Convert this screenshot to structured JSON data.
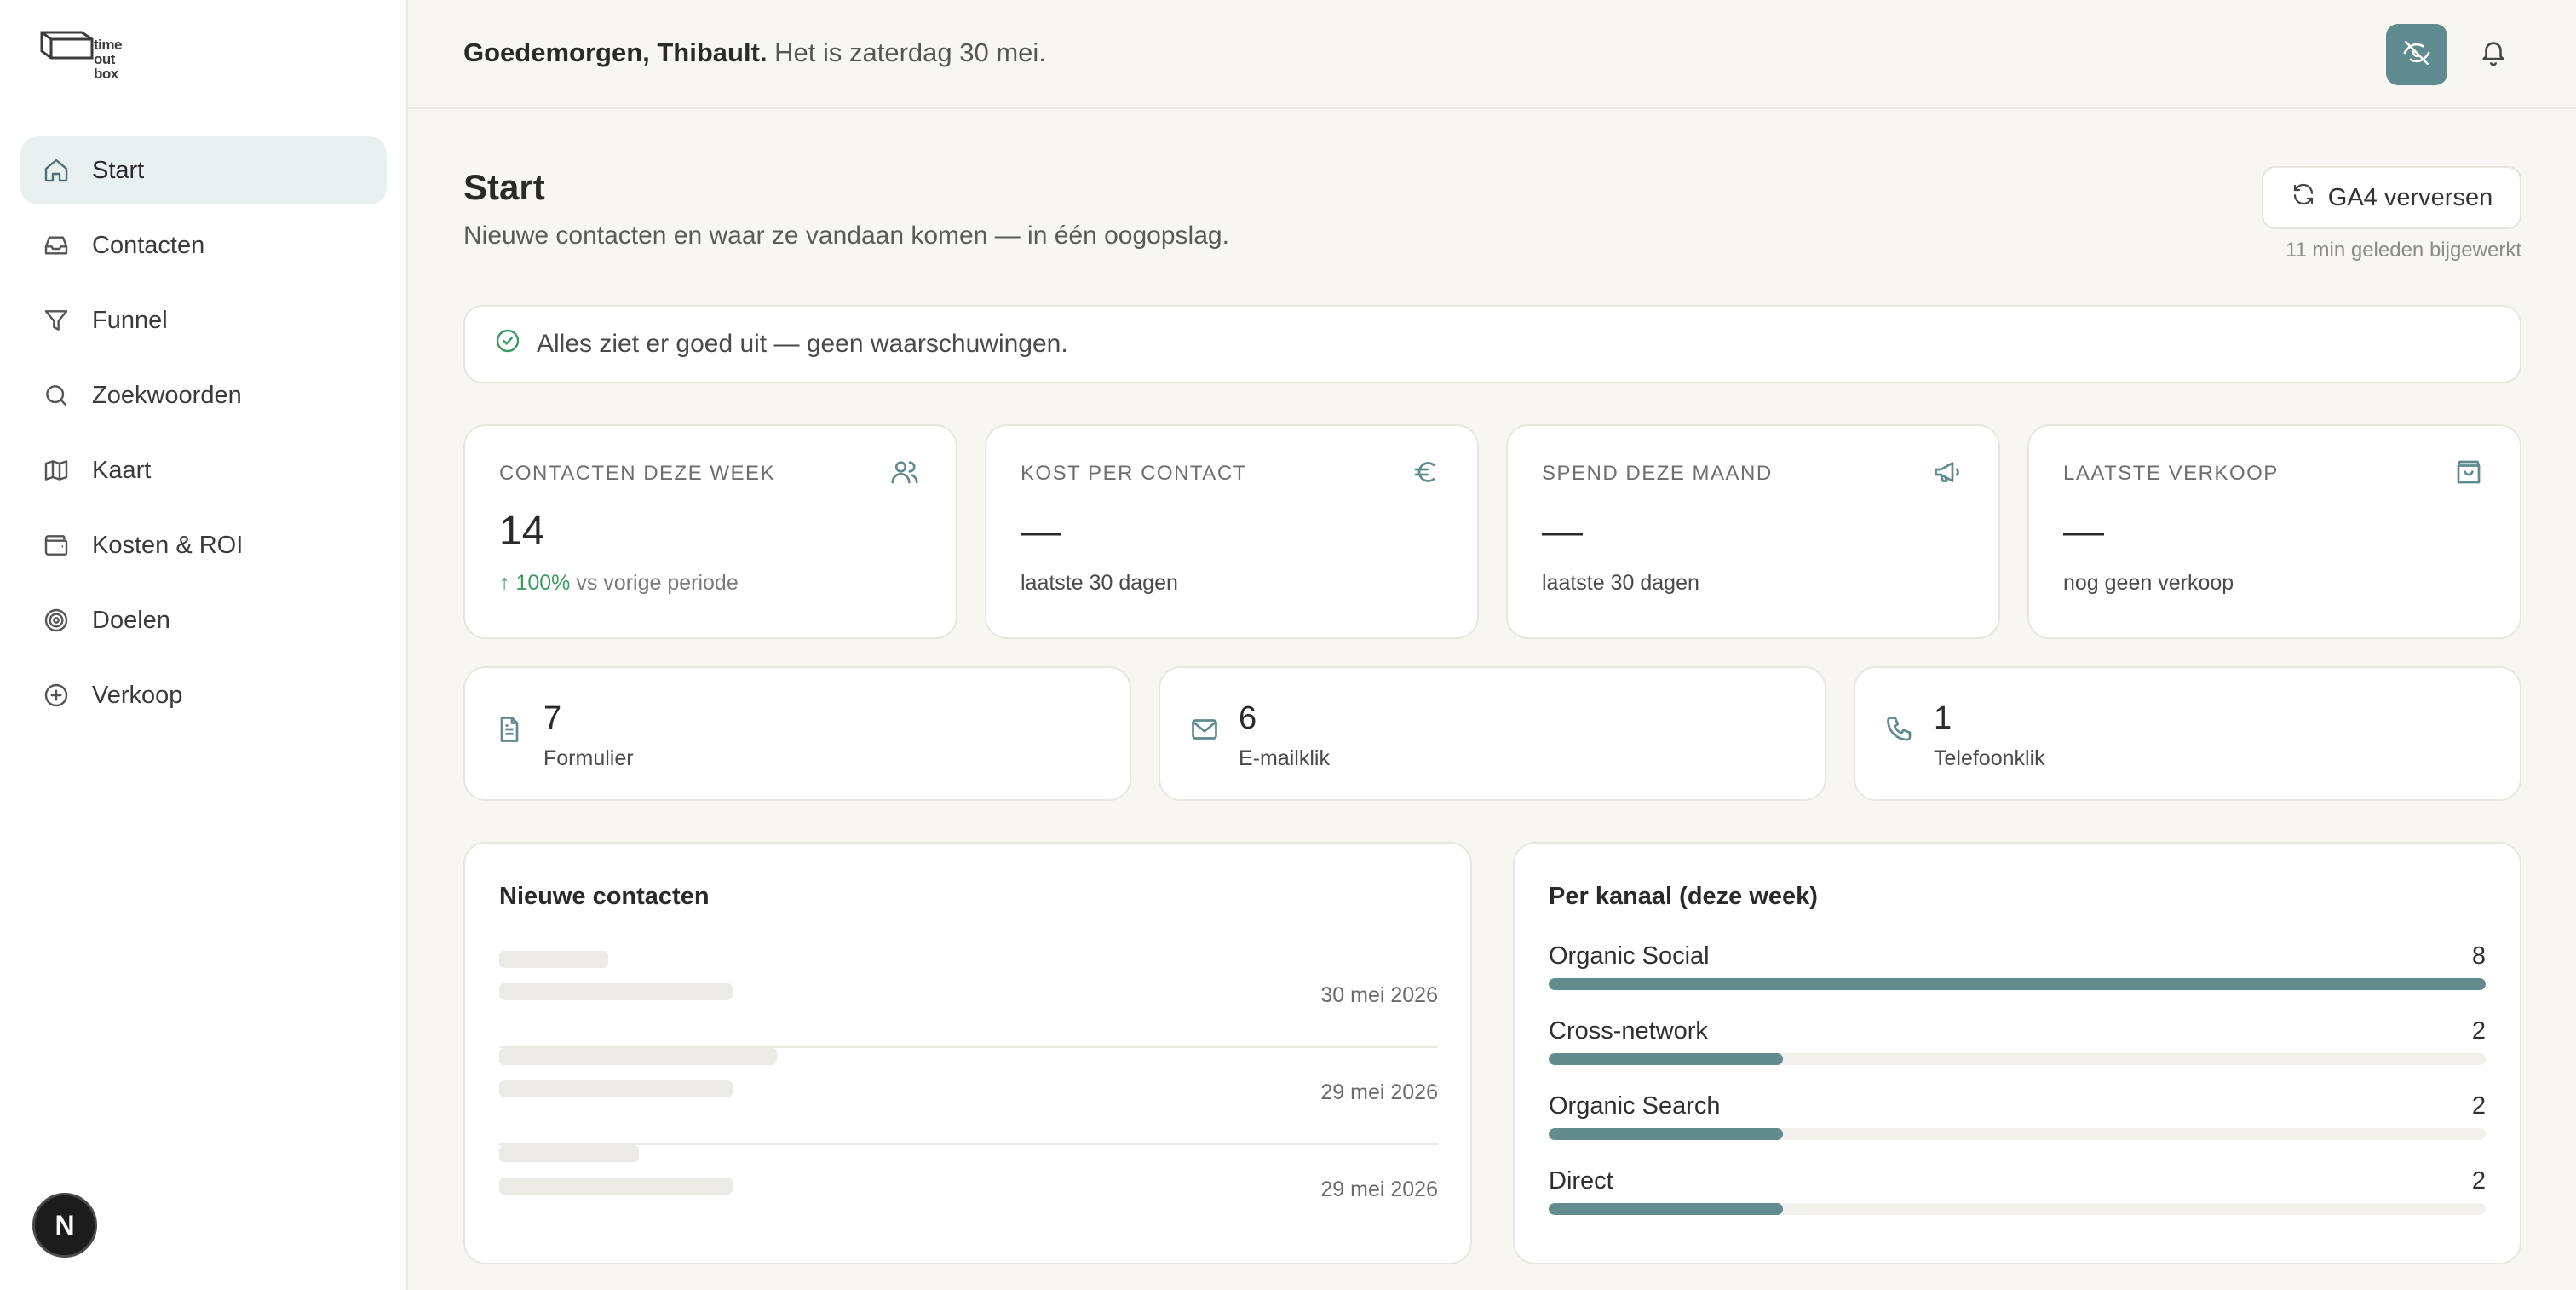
{
  "brand": {
    "logo_lines": [
      "time",
      "out",
      "box"
    ]
  },
  "sidebar": {
    "items": [
      {
        "label": "Start",
        "icon": "home-icon",
        "active": true
      },
      {
        "label": "Contacten",
        "icon": "inbox-icon",
        "active": false
      },
      {
        "label": "Funnel",
        "icon": "funnel-icon",
        "active": false
      },
      {
        "label": "Zoekwoorden",
        "icon": "search-icon",
        "active": false
      },
      {
        "label": "Kaart",
        "icon": "map-icon",
        "active": false
      },
      {
        "label": "Kosten & ROI",
        "icon": "wallet-icon",
        "active": false
      },
      {
        "label": "Doelen",
        "icon": "target-icon",
        "active": false
      },
      {
        "label": "Verkoop",
        "icon": "plus-circle-icon",
        "active": false
      }
    ],
    "badge": "N"
  },
  "header": {
    "greeting_name": "Goedemorgen, Thibault.",
    "greeting_date": "Het is zaterdag 30 mei."
  },
  "page": {
    "title": "Start",
    "subtitle": "Nieuwe contacten en waar ze vandaan komen — in één oogopslag.",
    "refresh_label": "GA4 verversen",
    "updated": "11 min geleden bijgewerkt",
    "alert": "Alles ziet er goed uit — geen waarschuwingen."
  },
  "kpis": [
    {
      "label": "Contacten deze week",
      "icon": "users-icon",
      "value": "14",
      "change": "100%",
      "change_suffix": "vs vorige periode"
    },
    {
      "label": "Kost per contact",
      "icon": "euro-icon",
      "value": "—",
      "sub": "laatste 30 dagen"
    },
    {
      "label": "Spend deze maand",
      "icon": "megaphone-icon",
      "value": "—",
      "sub": "laatste 30 dagen"
    },
    {
      "label": "Laatste verkoop",
      "icon": "shopping-bag-icon",
      "value": "—",
      "sub": "nog geen verkoop"
    }
  ],
  "sources": [
    {
      "value": "7",
      "label": "Formulier",
      "icon": "document-icon"
    },
    {
      "value": "6",
      "label": "E-mailklik",
      "icon": "mail-icon"
    },
    {
      "value": "1",
      "label": "Telefoonklik",
      "icon": "phone-icon"
    }
  ],
  "contacts": {
    "title": "Nieuwe contacten",
    "rows": [
      {
        "date": "30 mei 2026"
      },
      {
        "date": "29 mei 2026"
      },
      {
        "date": "29 mei 2026"
      }
    ]
  },
  "channels": {
    "title": "Per kanaal (deze week)",
    "max": 8,
    "items": [
      {
        "name": "Organic Social",
        "value": 8
      },
      {
        "name": "Cross-network",
        "value": 2
      },
      {
        "name": "Organic Search",
        "value": 2
      },
      {
        "name": "Direct",
        "value": 2
      }
    ]
  },
  "colors": {
    "accent": "#5f8a8f",
    "bar": "#628b8e",
    "positive": "#3d9a5f"
  }
}
